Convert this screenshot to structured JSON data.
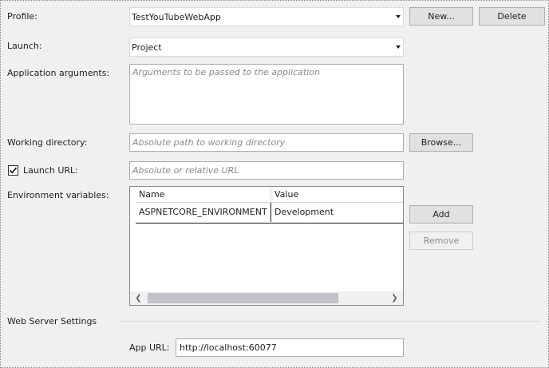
{
  "profile": {
    "label": "Profile:",
    "value": "TestYouTubeWebApp",
    "new_button": "New...",
    "delete_button": "Delete"
  },
  "launch": {
    "label": "Launch:",
    "value": "Project"
  },
  "app_args": {
    "label": "Application arguments:",
    "placeholder": "Arguments to be passed to the application"
  },
  "working_dir": {
    "label": "Working directory:",
    "placeholder": "Absolute path to working directory",
    "browse_button": "Browse..."
  },
  "launch_url": {
    "label": "Launch URL:",
    "checked": true,
    "placeholder": "Absolute or relative URL"
  },
  "env_vars": {
    "label": "Environment variables:",
    "columns": [
      "Name",
      "Value"
    ],
    "rows": [
      {
        "name": "ASPNETCORE_ENVIRONMENT",
        "value": "Development"
      }
    ],
    "add_button": "Add",
    "remove_button": "Remove"
  },
  "web_server": {
    "section_title": "Web Server Settings",
    "app_url_label": "App URL:",
    "app_url_value": "http://localhost:60077"
  }
}
